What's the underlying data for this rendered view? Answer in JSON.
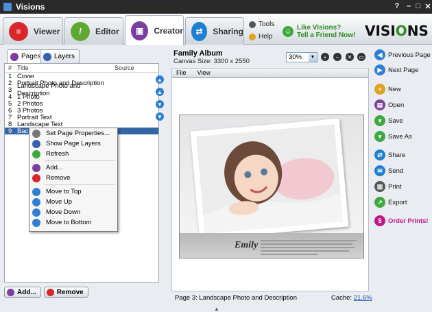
{
  "window": {
    "title": "Visions",
    "controls": [
      "?",
      "–",
      "□",
      "✕"
    ]
  },
  "main_tabs": [
    {
      "label": "Viewer",
      "color": "#d8262a",
      "glyph": "≡"
    },
    {
      "label": "Editor",
      "color": "#5ea833",
      "glyph": "/"
    },
    {
      "label": "Creator",
      "color": "#7b3fa0",
      "glyph": "▣"
    },
    {
      "label": "Sharing",
      "color": "#1e7fd0",
      "glyph": "⇄"
    }
  ],
  "top_links": {
    "tools": "Tools",
    "help": "Help"
  },
  "promo": {
    "line1": "Like Visions?",
    "line2": "Tell a Friend Now!"
  },
  "brand": {
    "pre": "VISI",
    "o": "O",
    "post": "NS"
  },
  "left": {
    "tabs": [
      "Pages",
      "Layers"
    ],
    "columns": [
      "#",
      "Title",
      "Source"
    ],
    "rows": [
      {
        "num": "1",
        "title": "Cover"
      },
      {
        "num": "2",
        "title": "Portrait Photo and Description"
      },
      {
        "num": "3",
        "title": "Landscape Photo and Description"
      },
      {
        "num": "4",
        "title": "1 Photo"
      },
      {
        "num": "5",
        "title": "2 Photos"
      },
      {
        "num": "6",
        "title": "3 Photos"
      },
      {
        "num": "7",
        "title": "Portrait Text"
      },
      {
        "num": "8",
        "title": "Landscape Text"
      },
      {
        "num": "9",
        "title": "Bac"
      }
    ],
    "add_label": "Add...",
    "remove_label": "Remove"
  },
  "context_menu": {
    "set_props": "Set Page Properties...",
    "show_layers": "Show Page Layers",
    "refresh": "Refresh",
    "add": "Add...",
    "remove": "Remove",
    "move_top": "Move to Top",
    "move_up": "Move Up",
    "move_down": "Move Down",
    "move_bottom": "Move to Bottom"
  },
  "center": {
    "album_title": "Family Album",
    "canvas_size": "Canvas Size: 3300 x 2550",
    "zoom": "30%",
    "menu": [
      "File",
      "View"
    ],
    "caption": "Emily",
    "status": "Page 3: Landscape Photo and Description",
    "cache_label": "Cache:",
    "cache_value": "21.6%"
  },
  "right": {
    "prev": "Previous Page",
    "next": "Next Page",
    "new": "New",
    "open": "Open",
    "save": "Save",
    "save_as": "Save As",
    "share": "Share",
    "send": "Send",
    "print": "Print",
    "export": "Export",
    "order": "Order Prints!"
  }
}
